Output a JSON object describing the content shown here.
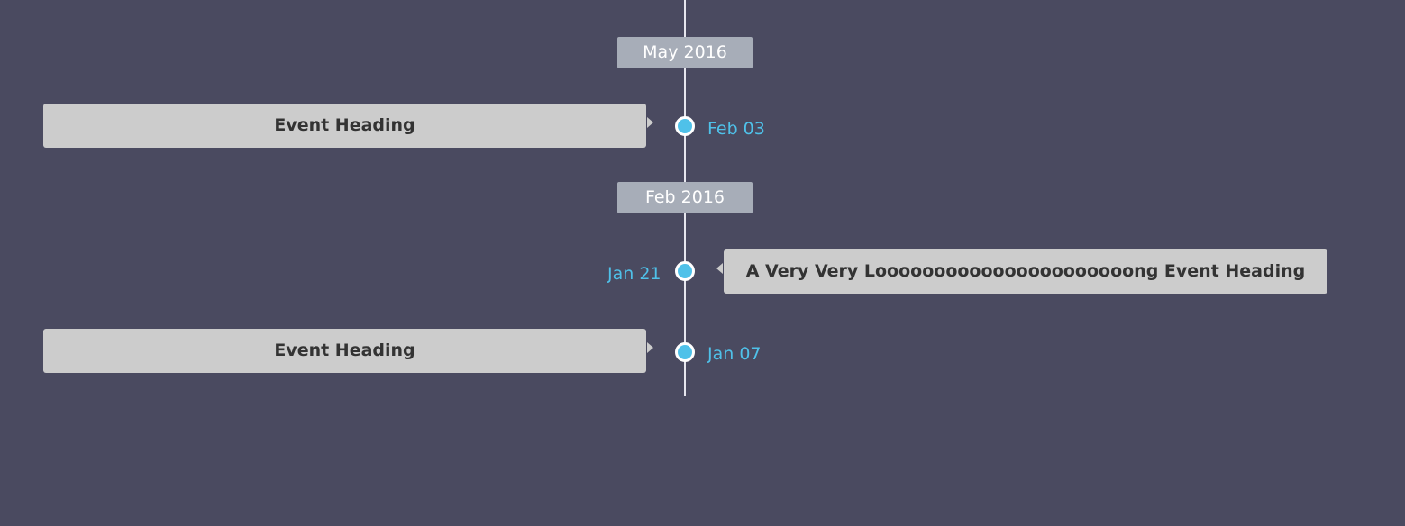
{
  "timeline": {
    "months": [
      {
        "label": "May 2016"
      },
      {
        "label": "Feb 2016"
      }
    ],
    "events": [
      {
        "date": "Feb 03",
        "heading": "Event Heading"
      },
      {
        "date": "Jan 21",
        "heading": "A Very Very Loooooooooooooooooooooong Event Heading"
      },
      {
        "date": "Jan 07",
        "heading": "Event Heading"
      }
    ]
  },
  "colors": {
    "background": "#4a4a60",
    "accent": "#4fc1e9",
    "card": "#cccccc",
    "month_label": "#a7adb8"
  }
}
